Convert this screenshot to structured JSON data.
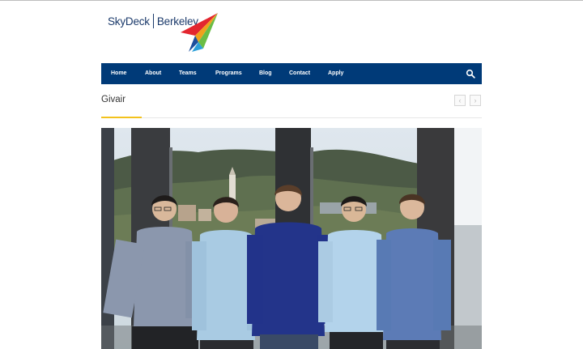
{
  "brand": {
    "name_left": "SkyDeck",
    "name_right": "Berkeley"
  },
  "nav": {
    "items": [
      "Home",
      "About",
      "Teams",
      "Programs",
      "Blog",
      "Contact",
      "Apply"
    ]
  },
  "page": {
    "title": "Givair"
  },
  "slider": {
    "prev_icon": "‹",
    "next_icon": "›"
  },
  "colors": {
    "nav_bg": "#003a78",
    "accent_underline": "#f3c21d"
  }
}
